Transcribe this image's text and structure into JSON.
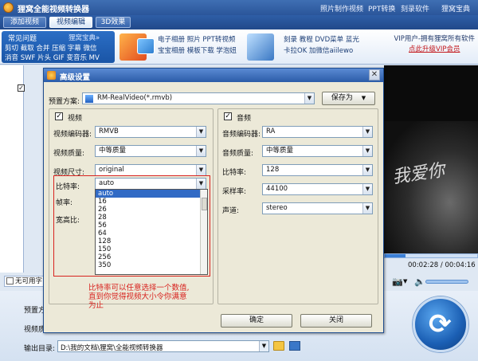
{
  "app": {
    "title": "狸窝全能视频转换器",
    "menu": [
      "照片制作视频",
      "PPT转换",
      "刻录软件",
      "狸窝宝典"
    ]
  },
  "tabs": [
    {
      "label": "添加视频",
      "active": false
    },
    {
      "label": "视频编辑",
      "active": true
    },
    {
      "label": "3D效果",
      "active": false
    }
  ],
  "ribbon": {
    "faq_title": "常见问题",
    "faq_title2": "狸窝宝典»",
    "faq_line1": "剪切 截取 合并 压缩 字幕 微信",
    "faq_line2": "消音 SWF 片头 GIF 变音乐 MV",
    "group1_line1": "电子相册 照片 PPT转视频",
    "group1_line2": "宝宝相册 模板下载 学泡妞",
    "group2_line1": "刻录 教程 DVD菜单 蓝光",
    "group2_line2": "卡拉OK 加微信aiilewo",
    "vip_line1": "VIP用户-拥有狸窝所有软件",
    "vip_link": "点此升级VIP会员"
  },
  "main": {
    "no_file_label": "无可用字",
    "preset_label": "预置方",
    "video_quality_label": "视频质",
    "output_label": "输出目录:",
    "output_path": "D:\\我的文档\\狸窝\\全能视频转换器",
    "time_current": "00:02:28",
    "time_total": "00:04:16",
    "seek_progress": 0.22
  },
  "dialog": {
    "title": "高级设置",
    "preset_label": "预置方案:",
    "preset_value": "RM-RealVideo(*.rmvb)",
    "save_as": "保存为",
    "video": {
      "header": "视频",
      "encoder_label": "视频编码器:",
      "encoder_value": "RMVB",
      "quality_label": "视频质量:",
      "quality_value": "中等质量",
      "size_label": "视频尺寸:",
      "size_value": "original",
      "bitrate_label": "比特率:",
      "bitrate_value": "auto",
      "framerate_label": "帧率:",
      "aspect_label": "宽高比:"
    },
    "audio": {
      "header": "音频",
      "encoder_label": "音频编码器:",
      "encoder_value": "RA",
      "quality_label": "音频质量:",
      "quality_value": "中等质量",
      "bitrate_label": "比特率:",
      "bitrate_value": "128",
      "samplerate_label": "采样率:",
      "samplerate_value": "44100",
      "channel_label": "声道:",
      "channel_value": "stereo"
    },
    "bitrate_options": [
      "auto",
      "16",
      "26",
      "28",
      "56",
      "64",
      "128",
      "150",
      "256",
      "350"
    ],
    "bitrate_selected": "auto",
    "note": "比特率可以任意选择一个数值,直到你觉得视频大小令你满意为止",
    "ok": "确定",
    "close": "关闭"
  },
  "colors": {
    "accent": "#2b5ca8",
    "annotation": "#d8231f",
    "vip_link": "#c2161b"
  }
}
